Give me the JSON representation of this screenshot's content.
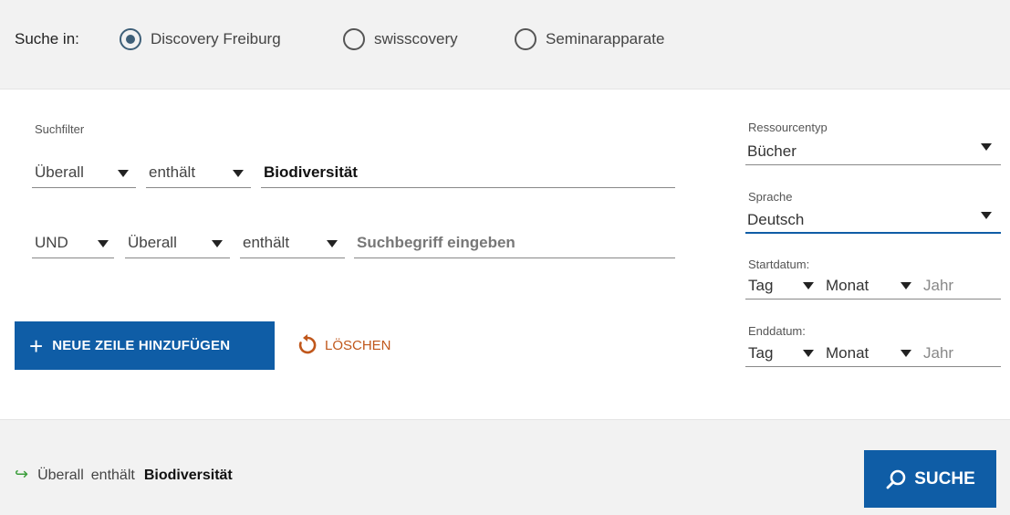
{
  "search_in": {
    "label": "Suche in:",
    "options": [
      {
        "label": "Discovery Freiburg",
        "selected": true
      },
      {
        "label": "swisscovery",
        "selected": false
      },
      {
        "label": "Seminarapparate",
        "selected": false
      }
    ]
  },
  "filters": {
    "label": "Suchfilter",
    "row1": {
      "field": "Überall",
      "operator": "enthält",
      "value": "Biodiversität"
    },
    "row2": {
      "boolean": "UND",
      "field": "Überall",
      "operator": "enthält",
      "placeholder": "Suchbegriff eingeben"
    }
  },
  "actions": {
    "add_row": "NEUE ZEILE HINZUFÜGEN",
    "clear": "LÖSCHEN"
  },
  "side": {
    "resource_type": {
      "label": "Ressourcentyp",
      "value": "Bücher"
    },
    "language": {
      "label": "Sprache",
      "value": "Deutsch"
    },
    "start_date": {
      "label": "Startdatum:",
      "day": "Tag",
      "month": "Monat",
      "year": "Jahr"
    },
    "end_date": {
      "label": "Enddatum:",
      "day": "Tag",
      "month": "Monat",
      "year": "Jahr"
    }
  },
  "summary": {
    "field": "Überall",
    "operator": "enthält",
    "term": "Biodiversität"
  },
  "search_button": "SUCHE",
  "colors": {
    "primary": "#0f5da6",
    "accent": "#c0571b",
    "arrow": "#3a9d3a",
    "radio": "#3e5f78"
  }
}
